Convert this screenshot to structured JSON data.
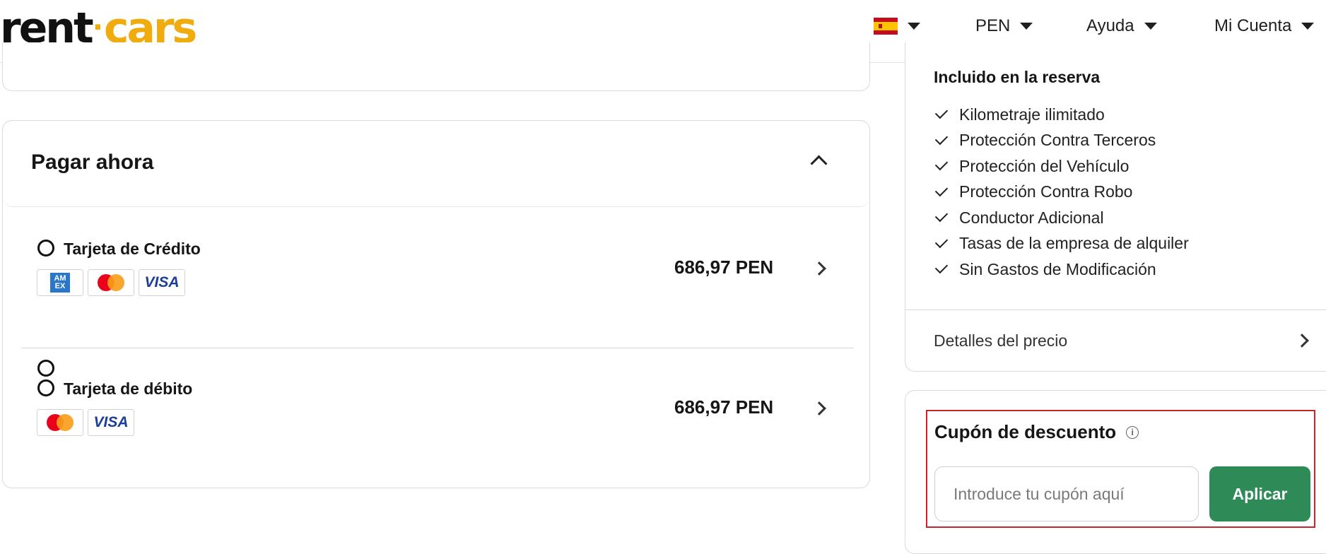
{
  "header": {
    "logo_left": "rent",
    "logo_right": "cars",
    "language_icon": "spain-flag-icon",
    "currency": "PEN",
    "help": "Ayuda",
    "account": "Mi Cuenta"
  },
  "payment": {
    "title": "Pagar ahora",
    "options": [
      {
        "label": "Tarjeta de Crédito",
        "brands": [
          "amex",
          "mastercard",
          "visa"
        ],
        "price": "686,97 PEN"
      },
      {
        "label": "Tarjeta de débito",
        "brands": [
          "mastercard",
          "visa"
        ],
        "price": "686,97 PEN"
      }
    ],
    "visa_text": "VISA",
    "amex_text_1": "AM",
    "amex_text_2": "EX"
  },
  "included": {
    "title": "Incluido en la reserva",
    "items": [
      "Kilometraje ilimitado",
      "Protección Contra Terceros",
      "Protección del Vehículo",
      "Protección Contra Robo",
      "Conductor Adicional",
      "Tasas de la empresa de alquiler",
      "Sin Gastos de Modificación"
    ],
    "price_details": "Detalles del precio"
  },
  "coupon": {
    "title": "Cupón de descuento",
    "placeholder": "Introduce tu cupón aquí",
    "button": "Aplicar"
  },
  "colors": {
    "brand_yellow": "#f0ac0f",
    "apply_green": "#2e8b57",
    "highlight_red": "#c4262e"
  }
}
